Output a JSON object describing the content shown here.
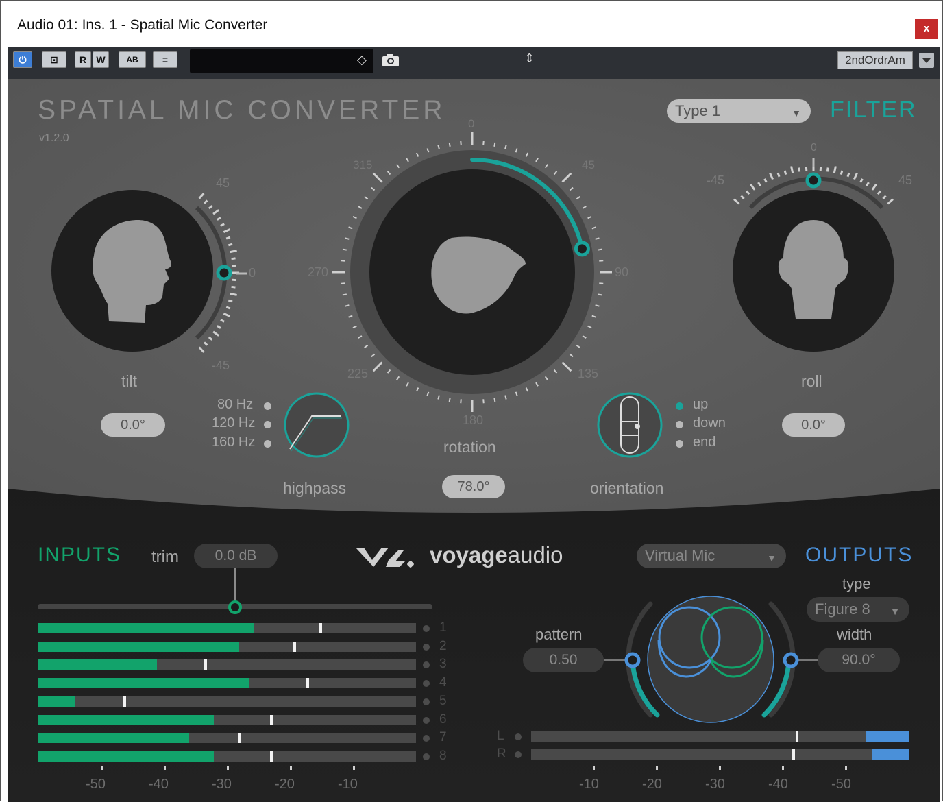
{
  "window": {
    "title": "Audio 01: Ins. 1 - Spatial Mic Converter",
    "close_label": "x"
  },
  "host_toolbar": {
    "power_label": "⏻",
    "bypass_label": "⊡",
    "read_label": "R",
    "write_label": "W",
    "ab_label": "AB",
    "settings_label": "≡",
    "preset_name_value": "",
    "preset_arrows": "⇕",
    "preset_menu_icon": "◇",
    "snapshot_icon": "camera-icon",
    "routing_preset": "2ndOrdrAm"
  },
  "plugin": {
    "title": "SPATIAL MIC CONVERTER",
    "version": "v1.2.0",
    "filter_type": "Type 1",
    "filter_label": "FILTER",
    "tilt": {
      "label": "tilt",
      "value": "0.0°",
      "scale_top": "45",
      "scale_mid": "0",
      "scale_bottom": "-45"
    },
    "rotation": {
      "label": "rotation",
      "value": "78.0°",
      "degrees": 78,
      "scale": {
        "n": "0",
        "ne": "45",
        "e": "90",
        "se": "135",
        "s": "180",
        "sw": "225",
        "w": "270",
        "nw": "315"
      }
    },
    "roll": {
      "label": "roll",
      "value": "0.0°",
      "scale_left": "-45",
      "scale_mid": "0",
      "scale_right": "45"
    },
    "highpass": {
      "label": "highpass",
      "options": [
        "80 Hz",
        "120 Hz",
        "160 Hz"
      ]
    },
    "orientation": {
      "label": "orientation",
      "options": [
        "up",
        "down",
        "end"
      ],
      "selected": "up"
    }
  },
  "inputs": {
    "title": "INPUTS",
    "trim_label": "trim",
    "trim_value": "0.0 dB",
    "trim_position": 0.5,
    "channels": [
      {
        "num": "1",
        "level": 0.57,
        "peak": 0.745
      },
      {
        "num": "2",
        "level": 0.533,
        "peak": 0.675
      },
      {
        "num": "3",
        "level": 0.315,
        "peak": 0.44
      },
      {
        "num": "4",
        "level": 0.56,
        "peak": 0.71
      },
      {
        "num": "5",
        "level": 0.098,
        "peak": 0.227
      },
      {
        "num": "6",
        "level": 0.465,
        "peak": 0.615
      },
      {
        "num": "7",
        "level": 0.4,
        "peak": 0.53
      },
      {
        "num": "8",
        "level": 0.465,
        "peak": 0.615
      }
    ],
    "scale": [
      "-50",
      "-40",
      "-30",
      "-20",
      "-10"
    ]
  },
  "brand": {
    "name_bold": "voyage",
    "name_light": "audio"
  },
  "outputs": {
    "title": "OUTPUTS",
    "mode": "Virtual Mic",
    "type_label": "type",
    "type_value": "Figure 8",
    "pattern_label": "pattern",
    "pattern_value": "0.50",
    "width_label": "width",
    "width_value": "90.0°",
    "channels": [
      {
        "label": "L",
        "level": 0.115,
        "peak": 0.7
      },
      {
        "label": "R",
        "level": 0.1,
        "peak": 0.69
      }
    ],
    "scale": [
      "-10",
      "-20",
      "-30",
      "-40",
      "-50"
    ]
  },
  "colors": {
    "teal": "#1aa39a",
    "green": "#12a36b",
    "blue": "#4a90d9",
    "panel": "#5e5e5e",
    "dark": "#1c1c1c"
  }
}
